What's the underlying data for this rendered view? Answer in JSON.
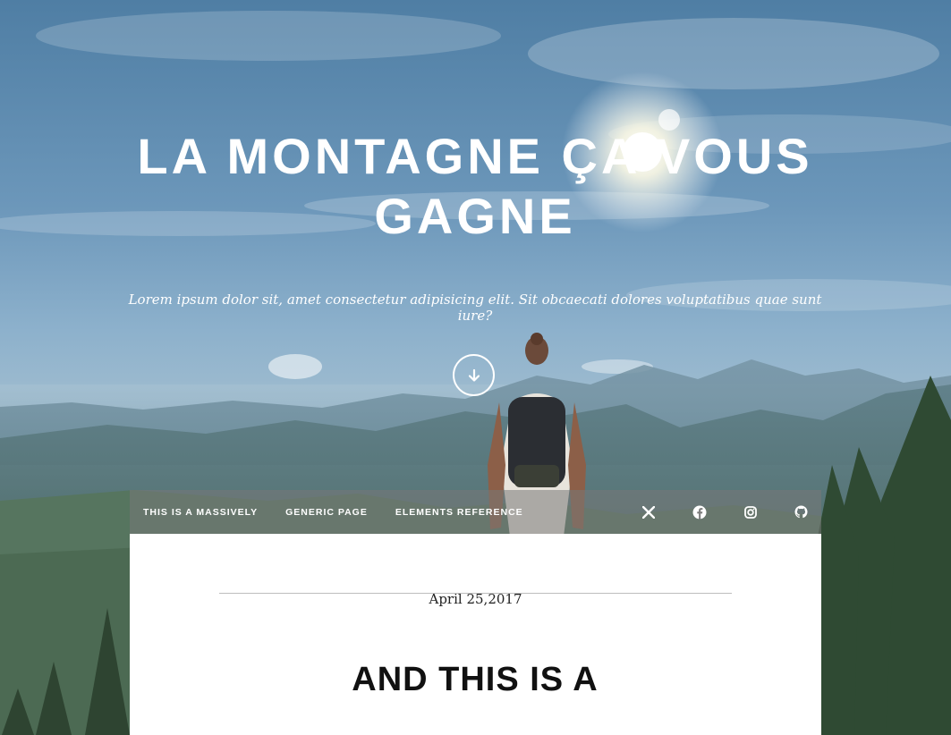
{
  "intro": {
    "title": "LA MONTAGNE ÇA VOUS GAGNE",
    "subtitle": "Lorem ipsum dolor sit, amet consectetur adipisicing elit. Sit obcaecati dolores voluptatibus quae sunt iure?",
    "scroll_icon": "arrow-down-icon"
  },
  "nav": {
    "links": [
      {
        "label": "THIS IS A MASSIVELY"
      },
      {
        "label": "GENERIC PAGE"
      },
      {
        "label": "ELEMENTS REFERENCE"
      }
    ],
    "social_icons": [
      "x-twitter-icon",
      "facebook-icon",
      "instagram-icon",
      "github-icon"
    ]
  },
  "post": {
    "date": "April 25,2017",
    "title": "AND THIS IS A"
  },
  "colors": {
    "sky": "#6c97ba",
    "nav_bg": "#787878",
    "panel": "#ffffff",
    "text_dark": "#111111"
  }
}
